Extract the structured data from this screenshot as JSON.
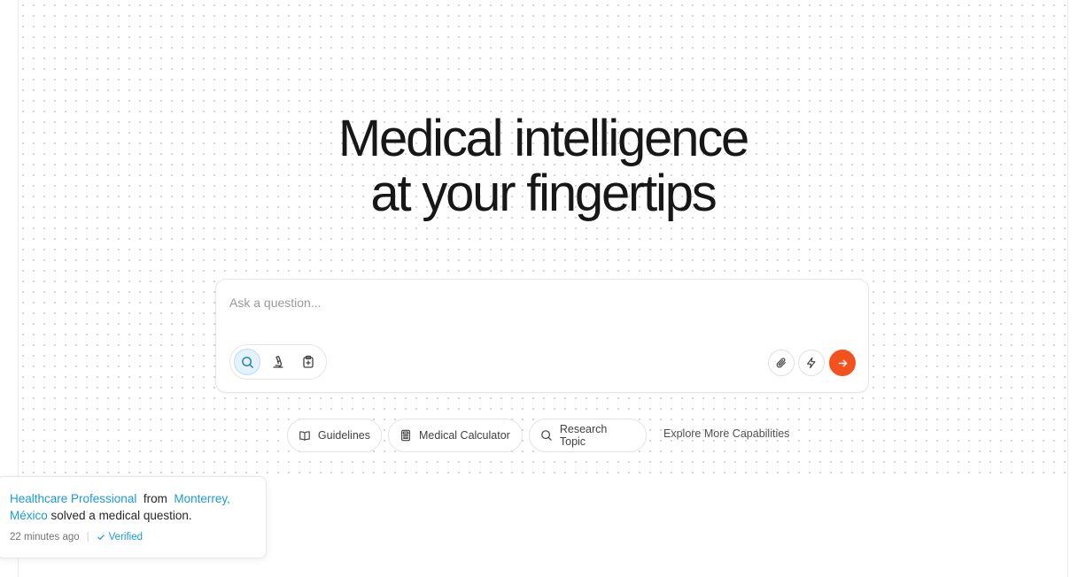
{
  "hero": {
    "line1": "Medical intelligence",
    "line2": "at your fingertips"
  },
  "ask": {
    "placeholder": "Ask a question...",
    "value": "",
    "modes": [
      {
        "icon": "search-icon",
        "active": true
      },
      {
        "icon": "microscope-icon",
        "active": false
      },
      {
        "icon": "clipboard-medical-icon",
        "active": false
      }
    ],
    "actions": [
      {
        "icon": "paperclip-icon"
      },
      {
        "icon": "lightning-icon"
      },
      {
        "icon": "arrow-right-icon"
      }
    ],
    "accent_color": "#f4511e"
  },
  "chips": [
    {
      "label": "Guidelines",
      "icon": "book-icon"
    },
    {
      "label": "Medical Calculator",
      "icon": "calculator-icon"
    },
    {
      "label": "Research Topic",
      "icon": "search-icon"
    }
  ],
  "explore_label": "Explore More Capabilities",
  "toast": {
    "role": "Healthcare Professional",
    "from_word": "from",
    "location": "Monterrey, México",
    "action": "solved a medical question.",
    "time": "22 minutes ago",
    "verified_label": "Verified",
    "link_color": "#1a9bd7"
  }
}
